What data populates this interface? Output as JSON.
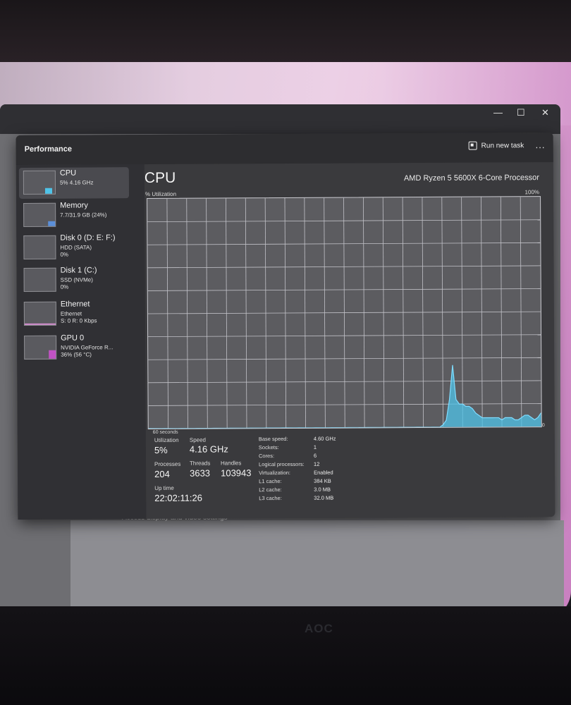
{
  "window": {
    "header_title": "Performance",
    "run_task_label": "Run new task",
    "more_label": "...",
    "controls": {
      "minimize": "—",
      "maximize": "☐",
      "close": "✕"
    }
  },
  "background": {
    "monitor_brand": "AOC",
    "settings_text": "Access display and video settings"
  },
  "sidebar": {
    "items": [
      {
        "name": "CPU",
        "sub1": "5% 4.16 GHz",
        "sub2": "",
        "thumb_color": "#4fc3e8"
      },
      {
        "name": "Memory",
        "sub1": "7.7/31.9 GB (24%)",
        "sub2": "",
        "thumb_color": "#5b8fd9"
      },
      {
        "name": "Disk 0 (D: E: F:)",
        "sub1": "HDD (SATA)",
        "sub2": "0%",
        "thumb_color": "#7ec77e"
      },
      {
        "name": "Disk 1 (C:)",
        "sub1": "SSD (NVMe)",
        "sub2": "0%",
        "thumb_color": "#7ec77e"
      },
      {
        "name": "Ethernet",
        "sub1": "Ethernet",
        "sub2": "S: 0 R: 0 Kbps",
        "thumb_color": "#d48fd0"
      },
      {
        "name": "GPU 0",
        "sub1": "NVIDIA GeForce R...",
        "sub2": "36% (56 °C)",
        "thumb_color": "#c152c4"
      }
    ]
  },
  "main": {
    "title": "CPU",
    "model": "AMD Ryzen 5 5600X 6-Core Processor",
    "util_label": "% Utilization",
    "util_max": "100%",
    "time_left": "60 seconds",
    "time_right": "0",
    "graph_color": "#4fc3e8",
    "graph_samples": [
      0,
      0,
      0,
      0,
      0,
      0,
      0,
      0,
      0,
      0,
      0,
      0,
      0,
      0,
      0,
      0,
      0,
      0,
      0,
      0,
      0,
      0,
      0,
      0,
      0,
      0,
      0,
      0,
      0,
      0,
      0,
      0,
      0,
      0,
      0,
      0,
      0,
      0,
      0,
      0,
      0,
      0,
      0,
      0,
      0,
      0,
      0,
      0,
      0,
      0,
      0,
      0,
      0,
      0,
      0,
      0,
      0,
      0,
      0,
      0,
      0,
      0,
      0,
      0,
      0,
      0,
      0,
      0,
      0,
      0,
      0,
      0,
      0,
      0,
      0,
      0,
      0,
      0,
      0,
      0,
      0,
      0,
      0,
      0,
      0,
      0,
      0,
      0,
      0,
      0,
      1,
      3,
      12,
      27,
      12,
      10,
      10,
      9,
      9,
      8,
      6,
      5,
      4,
      4,
      4,
      4,
      4,
      4,
      3,
      4,
      4,
      4,
      3,
      3,
      4,
      5,
      5,
      4,
      3,
      4,
      6
    ],
    "stats": {
      "utilization_label": "Utilization",
      "utilization": "5%",
      "speed_label": "Speed",
      "speed": "4.16 GHz",
      "processes_label": "Processes",
      "processes": "204",
      "threads_label": "Threads",
      "threads": "3633",
      "handles_label": "Handles",
      "handles": "103943",
      "uptime_label": "Up time",
      "uptime": "22:02:11:26"
    },
    "specs": [
      {
        "label": "Base speed:",
        "value": "4.60 GHz"
      },
      {
        "label": "Sockets:",
        "value": "1"
      },
      {
        "label": "Cores:",
        "value": "6"
      },
      {
        "label": "Logical processors:",
        "value": "12"
      },
      {
        "label": "Virtualization:",
        "value": "Enabled"
      },
      {
        "label": "L1 cache:",
        "value": "384 KB"
      },
      {
        "label": "L2 cache:",
        "value": "3.0 MB"
      },
      {
        "label": "L3 cache:",
        "value": "32.0 MB"
      }
    ]
  }
}
